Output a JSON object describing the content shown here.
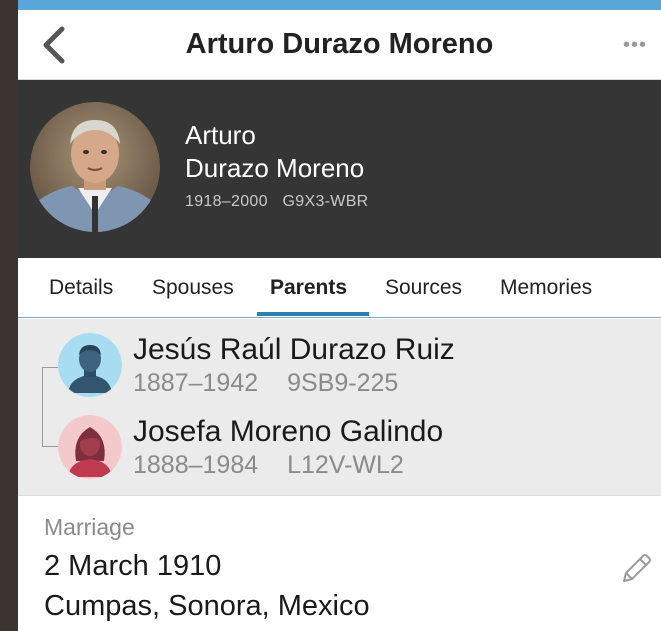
{
  "nav": {
    "title": "Arturo Durazo Moreno",
    "back_icon": "chevron-left-icon",
    "more_icon": "ellipsis-icon",
    "more_label": "•••"
  },
  "person": {
    "first_name": "Arturo",
    "last_name": "Durazo Moreno",
    "lifespan": "1918–2000",
    "pid": "G9X3-WBR"
  },
  "tabs": [
    {
      "label": "Details",
      "active": false
    },
    {
      "label": "Spouses",
      "active": false
    },
    {
      "label": "Parents",
      "active": true
    },
    {
      "label": "Sources",
      "active": false
    },
    {
      "label": "Memories",
      "active": false
    }
  ],
  "parents": [
    {
      "name": "Jesús Raúl Durazo Ruiz",
      "lifespan": "1887–1942",
      "pid": "9SB9-225",
      "icon": "male-avatar-icon"
    },
    {
      "name": "Josefa Moreno Galindo",
      "lifespan": "1888–1984",
      "pid": "L12V-WL2",
      "icon": "female-avatar-icon"
    }
  ],
  "marriage": {
    "label": "Marriage",
    "date": "2 March 1910",
    "place": "Cumpas, Sonora, Mexico",
    "edit_icon": "pencil-icon"
  },
  "colors": {
    "accent": "#5aa6d9",
    "header_bg": "#353535",
    "tab_active": "#2d7fb0",
    "parents_bg": "#ebebeb",
    "male_avatar_bg": "#a8dcf0",
    "female_avatar_bg": "#f4c9cc"
  }
}
